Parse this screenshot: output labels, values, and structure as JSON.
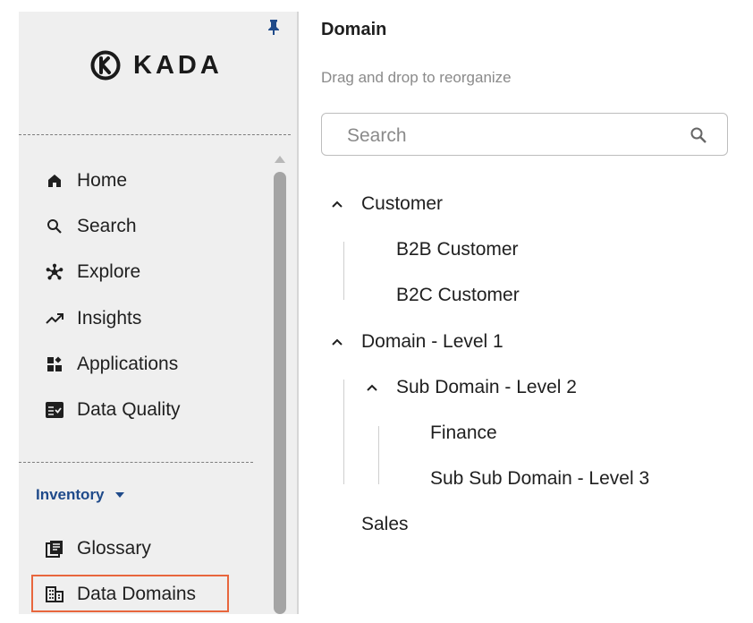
{
  "app": {
    "logo_text": "KADA"
  },
  "sidebar": {
    "nav": [
      {
        "label": "Home",
        "icon": "home-icon"
      },
      {
        "label": "Search",
        "icon": "search-icon"
      },
      {
        "label": "Explore",
        "icon": "explore-icon"
      },
      {
        "label": "Insights",
        "icon": "trending-up-icon"
      },
      {
        "label": "Applications",
        "icon": "applications-icon"
      },
      {
        "label": "Data Quality",
        "icon": "data-quality-icon"
      }
    ],
    "section": {
      "label": "Inventory",
      "icon": "caret-down-icon"
    },
    "inventory": [
      {
        "label": "Glossary",
        "icon": "glossary-icon"
      },
      {
        "label": "Data Domains",
        "icon": "data-domains-icon",
        "selected": true
      }
    ],
    "selected_outline_color": "#e8663d"
  },
  "panel": {
    "title": "Domain",
    "subtitle": "Drag and drop to reorganize",
    "search": {
      "placeholder": "Search",
      "value": ""
    },
    "tree": [
      {
        "label": "Customer",
        "level": 0,
        "expanded": true
      },
      {
        "label": "B2B Customer",
        "level": 1
      },
      {
        "label": "B2C Customer",
        "level": 1
      },
      {
        "label": "Domain - Level 1",
        "level": 0,
        "expanded": true
      },
      {
        "label": "Sub Domain - Level 2",
        "level": 1,
        "expanded": true
      },
      {
        "label": "Finance",
        "level": 2
      },
      {
        "label": "Sub Sub Domain - Level 3",
        "level": 2
      },
      {
        "label": "Sales",
        "level": 0
      }
    ]
  }
}
